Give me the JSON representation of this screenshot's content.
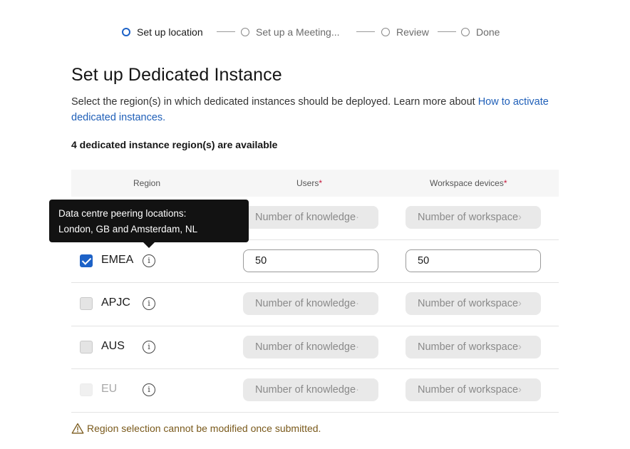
{
  "stepper": {
    "steps": [
      {
        "label": "Set up location",
        "active": true
      },
      {
        "label": "Set up a Meeting...",
        "active": false
      },
      {
        "label": "Review",
        "active": false
      },
      {
        "label": "Done",
        "active": false
      }
    ]
  },
  "page": {
    "title": "Set up Dedicated Instance",
    "description": "Select the region(s) in which dedicated instances should be deployed. Learn more about ",
    "link": "How to activate dedicated instances.",
    "available": "4 dedicated instance region(s) are available"
  },
  "table": {
    "headers": {
      "region": "Region",
      "users": "Users",
      "devices": "Workspace devices",
      "required_mark": "*"
    },
    "rows": [
      {
        "region": "",
        "checked": false,
        "users_placeholder": "Number of knowledge",
        "devices_placeholder": "Number of workspace"
      },
      {
        "region": "EMEA",
        "checked": true,
        "users_value": "50",
        "devices_value": "50"
      },
      {
        "region": "APJC",
        "checked": false,
        "users_placeholder": "Number of knowledge",
        "devices_placeholder": "Number of workspace"
      },
      {
        "region": "AUS",
        "checked": false,
        "users_placeholder": "Number of knowledge",
        "devices_placeholder": "Number of workspace"
      },
      {
        "region": "EU",
        "checked": false,
        "disabled": true,
        "users_placeholder": "Number of knowledge",
        "devices_placeholder": "Number of workspace"
      }
    ]
  },
  "tooltip": {
    "line1": "Data centre peering locations:",
    "line2": "London, GB and Amsterdam, NL"
  },
  "warning": {
    "text": "Region selection cannot be modified once submitted.",
    "icon": "warning-triangle-icon"
  },
  "colors": {
    "accent": "#1d62c7",
    "link": "#1f5fb8",
    "warning": "#7a5a1c",
    "required": "#c4183c"
  }
}
